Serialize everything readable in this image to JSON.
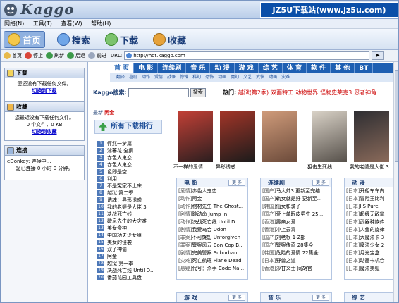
{
  "app": {
    "logo_text": "Kaggo",
    "watermark": "JZ5U下载站(www.jz5u.com)"
  },
  "menu": [
    "网络(N)",
    "工具(T)",
    "查看(W)",
    "帮助(H)"
  ],
  "toolbar": {
    "home": "首页",
    "search": "搜索",
    "download": "下载",
    "favorites": "收藏"
  },
  "nav": {
    "home": "首页",
    "stop": "停止",
    "refresh": "刷新",
    "back": "后退",
    "forward": "前进",
    "url_label": "URL:",
    "url": "http://hot.kaggo.com"
  },
  "sidebar": {
    "download": {
      "title": "下载",
      "text": "您还没有下载任何文件。",
      "link": "切换到下载"
    },
    "favorites": {
      "title": "收藏",
      "text": "您最近没有下载任何文件。",
      "stat": "0 个文件，0 KB",
      "link": "切换到收藏"
    },
    "connection": {
      "title": "连接",
      "status": "eDonkey: 连接中...",
      "time": "您已连接 0 小时 0 分钟。"
    }
  },
  "page": {
    "nav_main": [
      "首 页",
      "电 影",
      "连续剧",
      "音 乐",
      "动 漫",
      "游 戏",
      "综 艺",
      "体 育",
      "软 件",
      "其 他",
      "BT"
    ],
    "nav_sub": [
      "翻译",
      "喜剧",
      "动作",
      "爱情",
      "战争",
      "惊悚",
      "科幻",
      "恐怖",
      "动画",
      "魔幻",
      "文艺",
      "武侠",
      "动画",
      "灾难"
    ],
    "search_label": "Kaggo搜索:",
    "search_button": "搜索",
    "hot_label": "热门:",
    "hot_items": [
      "越狱(第2季)",
      "双面特工",
      "动物世界",
      "怪物史莱克3",
      "忍者神龟"
    ],
    "new_prefix": "最新",
    "new_item": "阿金",
    "rank_title": "所有下载排行",
    "rank": [
      "怦然一梦篇",
      "漆蕃花 全集",
      "赤色人鬼恋",
      "赤色人鬼恋",
      "色即是空",
      "利用",
      "不是冤家不上床",
      "越狱 第二季",
      "诱魂：异形诱惑",
      "我的老婆是大佬 3",
      "决战死亡线",
      "歇息先生的大灾难",
      "美女食神",
      "中国功夫少女组",
      "美女的侵袭",
      "双子神偷",
      "阿金",
      "越狱 第一季",
      "决战死亡线 Until D...",
      "番茄花园工具盘"
    ],
    "posters": [
      {
        "caption": "不一样的爱情",
        "colors": [
          "#c24036",
          "#2b1e1f"
        ]
      },
      {
        "caption": "异形诱惑",
        "colors": [
          "#a23528",
          "#1b1b1b"
        ]
      },
      {
        "caption": "",
        "colors": [
          "#cf9b7a",
          "#6b4a3a"
        ]
      },
      {
        "caption": "狙击生死线",
        "colors": [
          "#d9d2c7",
          "#56504a"
        ]
      },
      {
        "caption": "我的老婆是大佬 3",
        "colors": [
          "#2e2e32",
          "#8a6a5a"
        ]
      }
    ],
    "more": "更 多",
    "boxes": [
      {
        "title": "电 影",
        "items": [
          [
            "[爱情]",
            "赤色人鬼恋"
          ],
          [
            "[动作]",
            "阿金"
          ],
          [
            "[动作]",
            "棺材先生 The Ghost..."
          ],
          [
            "[剧情]",
            "跳动命 Jump In"
          ],
          [
            "[动作]",
            "决战死亡线 Until D..."
          ],
          [
            "[剧情]",
            "我爱乌合 Udon"
          ],
          [
            "[罪案]",
            "不可饶恕 Unforgiven"
          ],
          [
            "[罪案]",
            "警察风云 Bon Cop B..."
          ],
          [
            "[剧情]",
            "完美警察 Suburban"
          ],
          [
            "[灾难]",
            "死亡航班 Plane Dead"
          ],
          [
            "[悬疑]",
            "代号：杀手 Code Na..."
          ]
        ]
      },
      {
        "title": "连续剧",
        "items": [
          [
            "[国产]",
            "马大帅3 更新至完结"
          ],
          [
            "[国产]",
            "轨女就是好 更新至..."
          ],
          [
            "[韩国]",
            "仙女和骑子"
          ],
          [
            "[国产]",
            "爱上单眼皮男生 25..."
          ],
          [
            "[香港]",
            "男亲女爱"
          ],
          [
            "[香港]",
            "冲上云霄"
          ],
          [
            "[国产]",
            "刘老根 1-2部"
          ],
          [
            "[国产]",
            "警察传奇 28集全"
          ],
          [
            "[韩国]",
            "危险的爱情 22集全"
          ],
          [
            "[日本]",
            "野兽之道"
          ],
          [
            "[香港]",
            "沙甘义士 同胡官"
          ]
        ]
      },
      {
        "title": "动 漫",
        "items": [
          [
            "[日本]",
            "开船车车向"
          ],
          [
            "[日本]",
            "冒险王比利"
          ],
          [
            "[日本]",
            "I'S Pure"
          ],
          [
            "[日本]",
            "超级无敌掌"
          ],
          [
            "[日本]",
            "武器种族传"
          ],
          [
            "[日本]",
            "人鱼的旋律"
          ],
          [
            "[日本]",
            "大魔法卡 3"
          ],
          [
            "[日本]",
            "魔法少女 2"
          ],
          [
            "[日本]",
            "月光宝盒"
          ],
          [
            "[日本]",
            "动画卡机合"
          ],
          [
            "[日本]",
            "魔法美狐"
          ]
        ]
      }
    ],
    "bottom_boxes": [
      "游 戏",
      "音 乐",
      "综 艺"
    ]
  }
}
